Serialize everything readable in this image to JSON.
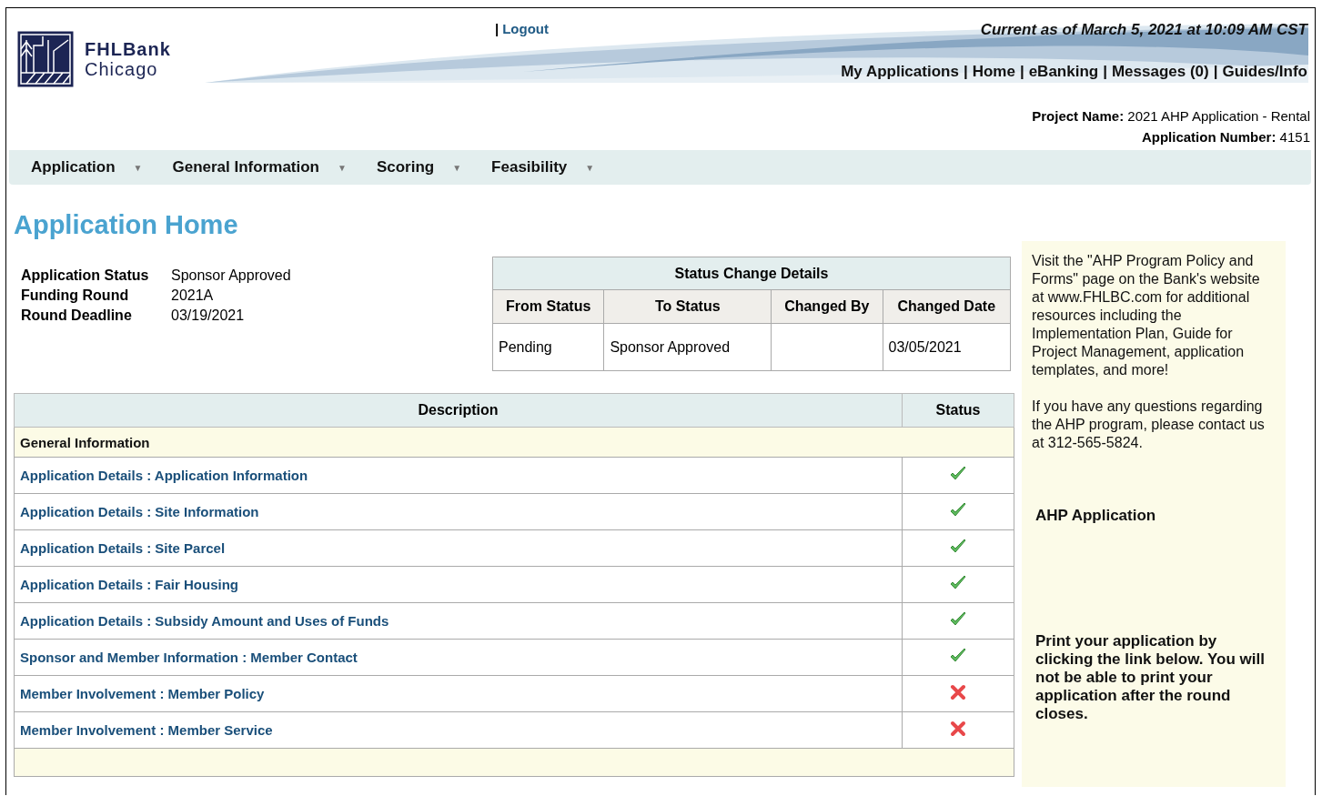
{
  "brand": {
    "line1": "FHLBank",
    "line2": "Chicago"
  },
  "header": {
    "logout": {
      "separator": "|",
      "label": "Logout"
    },
    "current_as_of": "Current as of March 5, 2021 at 10:09 AM CST",
    "separator": "|",
    "links": [
      "My Applications",
      "Home",
      "eBanking",
      "Messages (0)",
      "Guides/Info"
    ]
  },
  "project": [
    {
      "label": "Project Name:",
      "value": "2021 AHP Application - Rental"
    },
    {
      "label": "Application Number:",
      "value": "4151"
    }
  ],
  "menu": [
    {
      "label": "Application",
      "caret": "▼"
    },
    {
      "label": "General Information",
      "caret": "▼"
    },
    {
      "label": "Scoring",
      "caret": "▼"
    },
    {
      "label": "Feasibility",
      "caret": "▼"
    }
  ],
  "page_title": "Application Home",
  "summary": [
    {
      "label": "Application Status",
      "value": "Sponsor Approved"
    },
    {
      "label": "Funding Round",
      "value": "2021A"
    },
    {
      "label": "Round Deadline",
      "value": "03/19/2021"
    }
  ],
  "status_change": {
    "title": "Status Change Details",
    "columns": [
      "From Status",
      "To Status",
      "Changed By",
      "Changed Date"
    ],
    "rows": [
      [
        "Pending",
        "Sponsor Approved",
        "",
        "03/05/2021"
      ]
    ]
  },
  "table": {
    "columns": [
      "Description",
      "Status"
    ],
    "section": "General Information",
    "rows": [
      {
        "label": "Application Details : Application Information",
        "complete": true
      },
      {
        "label": "Application Details : Site Information",
        "complete": true
      },
      {
        "label": "Application Details : Site Parcel",
        "complete": true
      },
      {
        "label": "Application Details : Fair Housing",
        "complete": true
      },
      {
        "label": "Application Details : Subsidy Amount and Uses of Funds",
        "complete": true
      },
      {
        "label": "Sponsor and Member Information : Member Contact",
        "complete": true
      },
      {
        "label": "Member Involvement : Member Policy",
        "complete": false
      },
      {
        "label": "Member Involvement : Member Service",
        "complete": false
      }
    ]
  },
  "sidebar": {
    "paragraphs": [
      "Visit the \"AHP Program Policy and Forms\" page on the Bank's website at www.FHLBC.com for additional resources including the Implementation Plan, Guide for Project Management, application templates, and more!",
      "If you have any questions regarding the AHP program, please contact us at 312-565-5824."
    ],
    "heading": "AHP Application",
    "print_note": "Print your application by clicking the link below. You will not be able to print your application after the round closes."
  }
}
